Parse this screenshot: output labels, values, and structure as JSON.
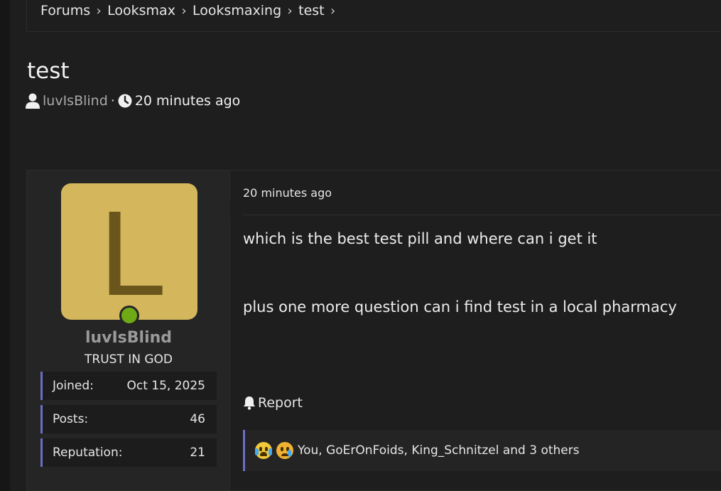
{
  "breadcrumb": [
    "Forums",
    "Looksmax",
    "Looksmaxing",
    "test"
  ],
  "thread": {
    "title": "test",
    "author": "luvIsBlind",
    "separator": "·",
    "time": "20 minutes ago"
  },
  "user": {
    "avatar_letter": "L",
    "name": "luvIsBlind",
    "title": "TRUST IN GOD",
    "stats": [
      {
        "label": "Joined:",
        "value": "Oct 15, 2025"
      },
      {
        "label": "Posts:",
        "value": "46"
      },
      {
        "label": "Reputation:",
        "value": "21"
      }
    ]
  },
  "post": {
    "time": "20 minutes ago",
    "lines": [
      "which is the best test pill and where can i get it",
      "plus one more question can i find test in a local pharmacy"
    ],
    "report_label": "Report",
    "reactions_text": "You, GoErOnFoids, King_Schnitzel and 3 others"
  },
  "colors": {
    "avatar_bg": "#d4b75c",
    "avatar_letter": "#6a561c",
    "online": "#6faa16",
    "accent_border": "#6b6fc4"
  },
  "icons": {
    "breadcrumb_separator": "chevron-right-icon",
    "author": "user-icon",
    "time": "clock-icon",
    "report": "bell-icon",
    "reactions": [
      "crying-laughing-emoji",
      "sad-tear-emoji"
    ]
  }
}
